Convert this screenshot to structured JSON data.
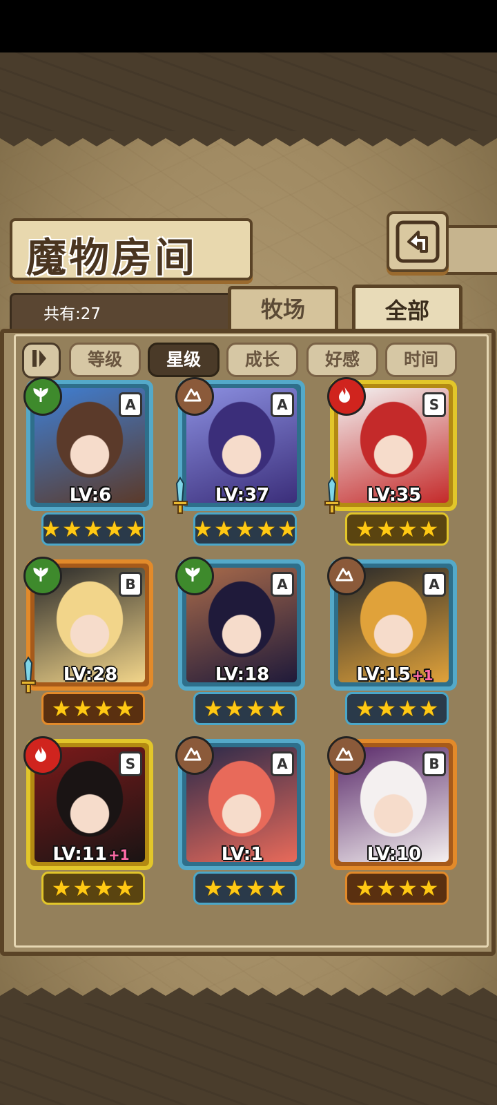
{
  "title": "魔物房间",
  "count_label": "共有:27",
  "tabs": [
    {
      "label": "牧场",
      "active": false
    },
    {
      "label": "全部",
      "active": true
    }
  ],
  "sort_buttons": [
    {
      "label": "等级",
      "active": false
    },
    {
      "label": "星级",
      "active": true
    },
    {
      "label": "成长",
      "active": false
    },
    {
      "label": "好感",
      "active": false
    },
    {
      "label": "时间",
      "active": false
    }
  ],
  "monsters": [
    {
      "rank": "A",
      "element": "grass",
      "level": "LV:6",
      "plus": "",
      "stars": 5,
      "weapon": false,
      "palette": [
        "#5b3a2a",
        "#3f7fd4"
      ]
    },
    {
      "rank": "A",
      "element": "earth",
      "level": "LV:37",
      "plus": "",
      "stars": 5,
      "weapon": true,
      "palette": [
        "#3b2e7a",
        "#8b8fe0"
      ]
    },
    {
      "rank": "S",
      "element": "fire",
      "level": "LV:35",
      "plus": "",
      "stars": 4,
      "weapon": true,
      "palette": [
        "#c42a2a",
        "#f3f3f3"
      ]
    },
    {
      "rank": "B",
      "element": "grass",
      "level": "LV:28",
      "plus": "",
      "stars": 4,
      "weapon": true,
      "palette": [
        "#f2d58a",
        "#2a2a2a"
      ]
    },
    {
      "rank": "A",
      "element": "grass",
      "level": "LV:18",
      "plus": "",
      "stars": 4,
      "weapon": false,
      "palette": [
        "#1f1a3a",
        "#a86a4a"
      ]
    },
    {
      "rank": "A",
      "element": "earth",
      "level": "LV:15",
      "plus": "+1",
      "stars": 4,
      "weapon": false,
      "palette": [
        "#e0a23a",
        "#2a2a2a"
      ]
    },
    {
      "rank": "S",
      "element": "fire",
      "level": "LV:11",
      "plus": "+1",
      "stars": 4,
      "weapon": false,
      "palette": [
        "#1a1414",
        "#7a1a1a"
      ]
    },
    {
      "rank": "A",
      "element": "earth",
      "level": "LV:1",
      "plus": "",
      "stars": 4,
      "weapon": false,
      "palette": [
        "#e86a5a",
        "#2a2a4a"
      ]
    },
    {
      "rank": "B",
      "element": "earth",
      "level": "LV:10",
      "plus": "",
      "stars": 4,
      "weapon": false,
      "palette": [
        "#f4f0f0",
        "#5a2a6a"
      ]
    }
  ]
}
